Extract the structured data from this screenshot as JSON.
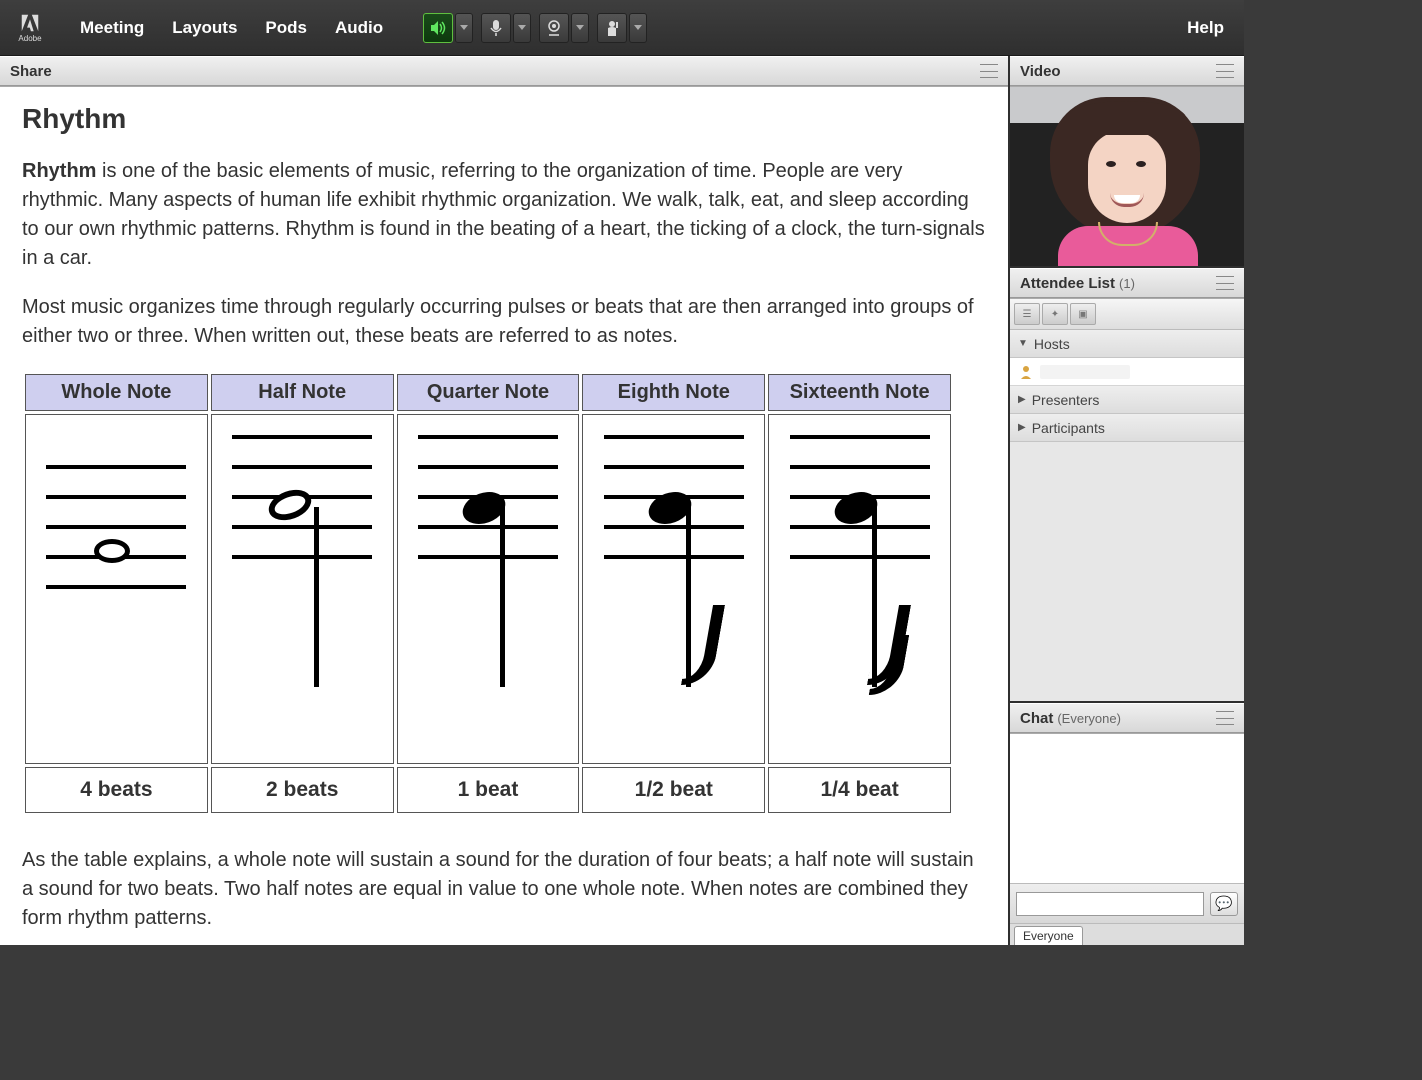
{
  "menubar": {
    "brand": "Adobe",
    "items": [
      "Meeting",
      "Layouts",
      "Pods",
      "Audio"
    ],
    "help": "Help"
  },
  "share": {
    "title": "Share",
    "doc_title": "Rhythm",
    "p1_lead": "Rhythm",
    "p1_rest": " is one of the basic elements of music, referring to the organization of time. People are very rhythmic. Many aspects of human life exhibit rhythmic organization. We walk, talk, eat, and sleep according to our own rhythmic patterns. Rhythm is found in the beating of a heart, the ticking of a clock, the turn-signals in a car.",
    "p2": "Most music organizes time through regularly occurring pulses or beats that are then arranged into groups of either two or three. When written out, these beats are referred to as notes.",
    "table": {
      "headers": [
        "Whole Note",
        "Half Note",
        "Quarter Note",
        "Eighth Note",
        "Sixteenth Note"
      ],
      "beats": [
        "4 beats",
        "2 beats",
        "1 beat",
        "1/2 beat",
        "1/4 beat"
      ]
    },
    "p3": "As the table explains, a whole note will sustain a sound for the duration of four beats; a half note will sustain a sound for two beats. Two half notes are equal in value to one whole note. When notes are combined they form rhythm patterns."
  },
  "video": {
    "title": "Video"
  },
  "attendees": {
    "title": "Attendee List",
    "count": "(1)",
    "sections": {
      "hosts": "Hosts",
      "presenters": "Presenters",
      "participants": "Participants"
    }
  },
  "chat": {
    "title": "Chat",
    "scope": "(Everyone)",
    "placeholder": "",
    "tab": "Everyone"
  }
}
